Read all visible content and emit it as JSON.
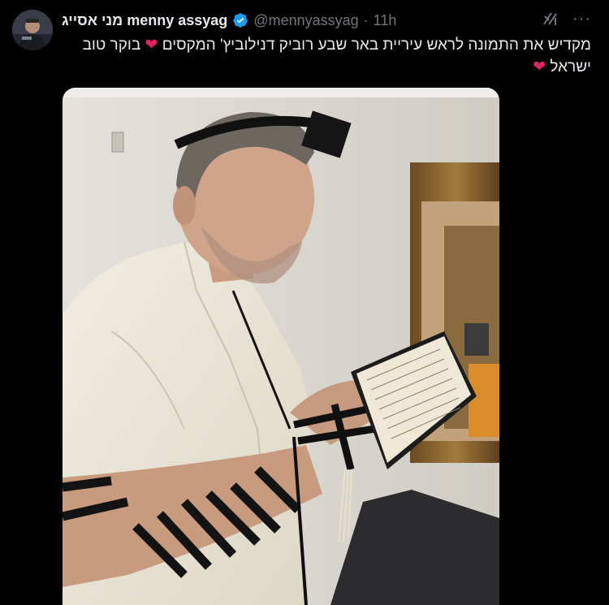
{
  "user": {
    "display_name": "מני אסייג menny assyag",
    "handle": "@mennyassyag",
    "separator": "·",
    "time": "11h",
    "verified": true
  },
  "tweet": {
    "text_line1": "מקדיש את התמונה לראש עיריית באר שבע רוביק דנילוביץ' המקסים",
    "text_line1_end": "בוקר טוב",
    "text_line2": "ישראל",
    "heart": "❤",
    "heart_color": "#e0245e"
  },
  "icons": {
    "grok": "grok-icon",
    "more": "more-icon",
    "more_glyph": "···",
    "verified": "verified-badge-icon"
  },
  "colors": {
    "background": "#000000",
    "text": "#e7e9ea",
    "secondary": "#71767b",
    "verified": "#1d9bf0"
  }
}
